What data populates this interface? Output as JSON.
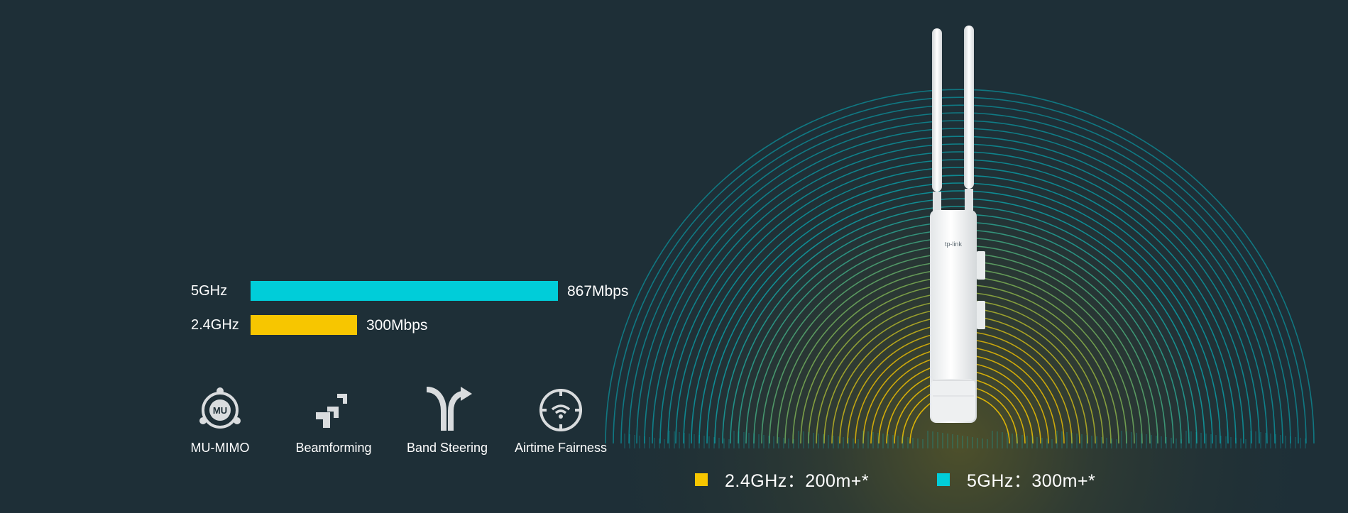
{
  "colors": {
    "background": "#1e2f37",
    "band_5ghz": "#00cdd9",
    "band_24ghz": "#f7c600",
    "icon_fill": "#d9dcde"
  },
  "speeds": [
    {
      "band": "5GHz",
      "value": "867Mbps",
      "mbps": 867,
      "color": "#00cdd9"
    },
    {
      "band": "2.4GHz",
      "value": "300Mbps",
      "mbps": 300,
      "color": "#f7c600"
    }
  ],
  "features": [
    {
      "icon": "mu-mimo-icon",
      "label": "MU-MIMO"
    },
    {
      "icon": "beamforming-icon",
      "label": "Beamforming"
    },
    {
      "icon": "band-steering-icon",
      "label": "Band Steering"
    },
    {
      "icon": "airtime-fairness-icon",
      "label": "Airtime Fairness"
    }
  ],
  "legend": [
    {
      "text": "2.4GHz：200m+*",
      "color": "#f7c600"
    },
    {
      "text": "5GHz：300m+*",
      "color": "#00cdd9"
    }
  ],
  "device": {
    "brand": "tp-link"
  }
}
